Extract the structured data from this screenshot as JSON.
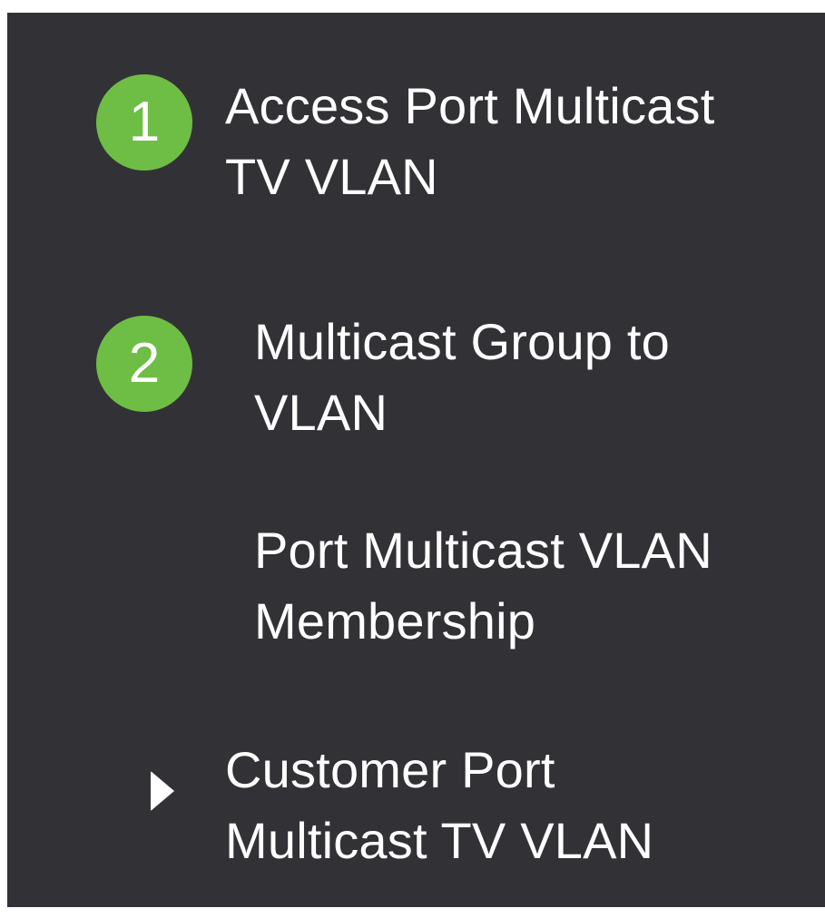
{
  "badges": {
    "first": "1",
    "second": "2",
    "color": "#6ebe45"
  },
  "menu": {
    "items": [
      {
        "lines": [
          "Access Port Multicast",
          "TV VLAN"
        ]
      },
      {
        "lines": [
          "Multicast Group to",
          "VLAN"
        ]
      },
      {
        "lines": [
          "Port Multicast VLAN",
          "Membership"
        ]
      },
      {
        "lines": [
          "Customer Port",
          "Multicast TV VLAN"
        ],
        "icon": "caret-right-icon"
      }
    ]
  },
  "colors": {
    "panel_background": "#323236",
    "text": "#ffffff"
  }
}
